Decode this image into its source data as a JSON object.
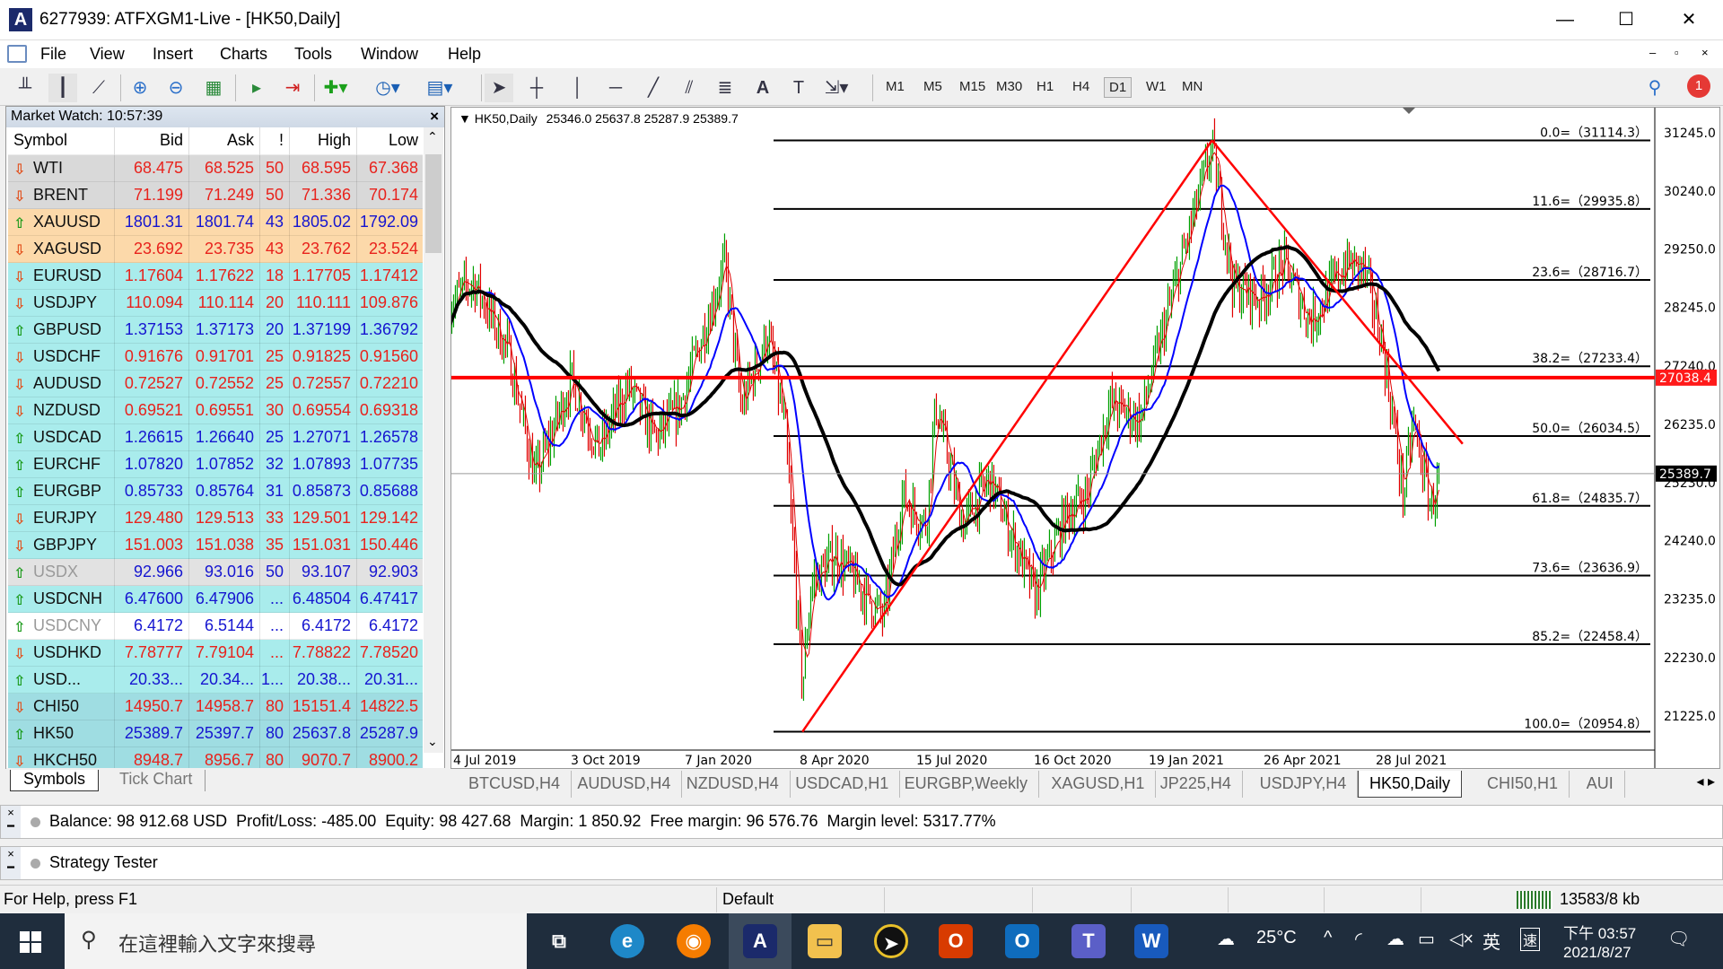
{
  "window": {
    "title": "6277939: ATFXGM1-Live - [HK50,Daily]",
    "minimize": "—",
    "maximize": "☐",
    "close": "✕"
  },
  "menu": [
    "File",
    "View",
    "Insert",
    "Charts",
    "Tools",
    "Window",
    "Help"
  ],
  "toolbar": {
    "timeframes": [
      "M1",
      "M5",
      "M15",
      "M30",
      "H1",
      "H4",
      "D1",
      "W1",
      "MN"
    ],
    "active_timeframe": "D1",
    "notification_count": "1"
  },
  "market_watch": {
    "title": "Market Watch: 10:57:39",
    "close": "×",
    "columns": [
      "Symbol",
      "Bid",
      "Ask",
      "!",
      "High",
      "Low"
    ],
    "rows": [
      {
        "symbol": "WTI",
        "bid": "68.475",
        "ask": "68.525",
        "spread": "50",
        "high": "68.595",
        "low": "67.368",
        "dir": "down",
        "bg": "#d9d9d9"
      },
      {
        "symbol": "BRENT",
        "bid": "71.199",
        "ask": "71.249",
        "spread": "50",
        "high": "71.336",
        "low": "70.174",
        "dir": "down",
        "bg": "#d9d9d9"
      },
      {
        "symbol": "XAUUSD",
        "bid": "1801.31",
        "ask": "1801.74",
        "spread": "43",
        "high": "1805.02",
        "low": "1792.09",
        "dir": "up",
        "bg": "#fcd9aa"
      },
      {
        "symbol": "XAGUSD",
        "bid": "23.692",
        "ask": "23.735",
        "spread": "43",
        "high": "23.762",
        "low": "23.524",
        "dir": "down",
        "bg": "#fcd9aa"
      },
      {
        "symbol": "EURUSD",
        "bid": "1.17604",
        "ask": "1.17622",
        "spread": "18",
        "high": "1.17705",
        "low": "1.17412",
        "dir": "down",
        "bg": "#a9ecec"
      },
      {
        "symbol": "USDJPY",
        "bid": "110.094",
        "ask": "110.114",
        "spread": "20",
        "high": "110.111",
        "low": "109.876",
        "dir": "down",
        "bg": "#a9ecec"
      },
      {
        "symbol": "GBPUSD",
        "bid": "1.37153",
        "ask": "1.37173",
        "spread": "20",
        "high": "1.37199",
        "low": "1.36792",
        "dir": "up",
        "bg": "#a9ecec"
      },
      {
        "symbol": "USDCHF",
        "bid": "0.91676",
        "ask": "0.91701",
        "spread": "25",
        "high": "0.91825",
        "low": "0.91560",
        "dir": "down",
        "bg": "#a9ecec"
      },
      {
        "symbol": "AUDUSD",
        "bid": "0.72527",
        "ask": "0.72552",
        "spread": "25",
        "high": "0.72557",
        "low": "0.72210",
        "dir": "down",
        "bg": "#a9ecec"
      },
      {
        "symbol": "NZDUSD",
        "bid": "0.69521",
        "ask": "0.69551",
        "spread": "30",
        "high": "0.69554",
        "low": "0.69318",
        "dir": "down",
        "bg": "#a9ecec"
      },
      {
        "symbol": "USDCAD",
        "bid": "1.26615",
        "ask": "1.26640",
        "spread": "25",
        "high": "1.27071",
        "low": "1.26578",
        "dir": "up",
        "bg": "#a9ecec"
      },
      {
        "symbol": "EURCHF",
        "bid": "1.07820",
        "ask": "1.07852",
        "spread": "32",
        "high": "1.07893",
        "low": "1.07735",
        "dir": "up",
        "bg": "#a9ecec"
      },
      {
        "symbol": "EURGBP",
        "bid": "0.85733",
        "ask": "0.85764",
        "spread": "31",
        "high": "0.85873",
        "low": "0.85688",
        "dir": "up",
        "bg": "#a9ecec"
      },
      {
        "symbol": "EURJPY",
        "bid": "129.480",
        "ask": "129.513",
        "spread": "33",
        "high": "129.501",
        "low": "129.142",
        "dir": "down",
        "bg": "#a9ecec"
      },
      {
        "symbol": "GBPJPY",
        "bid": "151.003",
        "ask": "151.038",
        "spread": "35",
        "high": "151.031",
        "low": "150.446",
        "dir": "down",
        "bg": "#a9ecec"
      },
      {
        "symbol": "USDX",
        "bid": "92.966",
        "ask": "93.016",
        "spread": "50",
        "high": "93.107",
        "low": "92.903",
        "dir": "up",
        "bg": "#e2e2e2",
        "muted": true
      },
      {
        "symbol": "USDCNH",
        "bid": "6.47600",
        "ask": "6.47906",
        "spread": "...",
        "high": "6.48504",
        "low": "6.47417",
        "dir": "up",
        "bg": "#a9ecec"
      },
      {
        "symbol": "USDCNY",
        "bid": "6.4172",
        "ask": "6.5144",
        "spread": "...",
        "high": "6.4172",
        "low": "6.4172",
        "dir": "up",
        "bg": "#ffffff",
        "muted": true
      },
      {
        "symbol": "USDHKD",
        "bid": "7.78777",
        "ask": "7.79104",
        "spread": "...",
        "high": "7.78822",
        "low": "7.78520",
        "dir": "down",
        "bg": "#a9ecec"
      },
      {
        "symbol": "USD...",
        "bid": "20.33...",
        "ask": "20.34...",
        "spread": "1...",
        "high": "20.38...",
        "low": "20.31...",
        "dir": "up",
        "bg": "#a9ecec"
      },
      {
        "symbol": "CHI50",
        "bid": "14950.7",
        "ask": "14958.7",
        "spread": "80",
        "high": "15151.4",
        "low": "14822.5",
        "dir": "down",
        "bg": "#9fdde2"
      },
      {
        "symbol": "HK50",
        "bid": "25389.7",
        "ask": "25397.7",
        "spread": "80",
        "high": "25637.8",
        "low": "25287.9",
        "dir": "up",
        "bg": "#9fdde2"
      },
      {
        "symbol": "HKCH50",
        "bid": "8948.7",
        "ask": "8956.7",
        "spread": "80",
        "high": "9070.7",
        "low": "8900.2",
        "dir": "down",
        "bg": "#9fdde2"
      }
    ],
    "tabs": [
      "Symbols",
      "Tick Chart"
    ],
    "active_tab": "Symbols"
  },
  "chart_tabs": [
    "BTCUSD,H4",
    "AUDUSD,H4",
    "NZDUSD,H4",
    "USDCAD,H1",
    "EURGBP,Weekly",
    "XAGUSD,H1",
    "JP225,H4",
    "USDJPY,H4",
    "HK50,Daily",
    "CHI50,H1",
    "AUI"
  ],
  "active_chart_tab": "HK50,Daily",
  "colors": {
    "up_bar": "#00a000",
    "down_bar": "#e00000",
    "sell_down": "#e8221c",
    "buy_up": "#1515d0",
    "fib": "#000000",
    "trendline": "#ff0000",
    "level_line": "#ff0000"
  },
  "chart_data": {
    "type": "bar",
    "header": "HK50,Daily",
    "ohlc": "25346.0 25637.8 25287.9 25389.7",
    "ylim": [
      20954.8,
      31245.0
    ],
    "y_ticks": [
      "31245.0",
      "30240.0",
      "29250.0",
      "28245.0",
      "27240.0",
      "26235.0",
      "25230.0",
      "24240.0",
      "23235.0",
      "22230.0",
      "21225.0"
    ],
    "x_ticks": [
      "4 Jul 2019",
      "3 Oct 2019",
      "7 Jan 2020",
      "8 Apr 2020",
      "15 Jul 2020",
      "16 Oct 2020",
      "19 Jan 2021",
      "26 Apr 2021",
      "28 Jul 2021"
    ],
    "fibonacci": [
      {
        "label": "0.0=（31114.3）",
        "price": 31114.3
      },
      {
        "label": "11.6=（29935.8）",
        "price": 29935.8
      },
      {
        "label": "23.6=（28716.7）",
        "price": 28716.7
      },
      {
        "label": "38.2=（27233.4）",
        "price": 27233.4
      },
      {
        "label": "50.0=（26034.5）",
        "price": 26034.5
      },
      {
        "label": "61.8=（24835.7）",
        "price": 24835.7
      },
      {
        "label": "73.6=（23636.9）",
        "price": 23636.9
      },
      {
        "label": "85.2=（22458.4）",
        "price": 22458.4
      },
      {
        "label": "100.0=（20954.8）",
        "price": 20954.8
      }
    ],
    "horizontal_line": {
      "price": 27038.4,
      "label": "27038.4"
    },
    "current_price": {
      "price": 25389.7,
      "label": "25389.7"
    },
    "trendlines": [
      {
        "from": [
          "2020-03-19",
          20954.8
        ],
        "to": [
          "2021-02-18",
          31114.3
        ]
      },
      {
        "from": [
          "2021-02-18",
          31114.3
        ],
        "to": [
          "2021-09-15",
          25900
        ]
      }
    ],
    "price_path": [
      [
        "2019-06-10",
        28300
      ],
      [
        "2019-06-28",
        28700
      ],
      [
        "2019-07-25",
        27500
      ],
      [
        "2019-08-15",
        25300
      ],
      [
        "2019-09-12",
        27000
      ],
      [
        "2019-10-03",
        25800
      ],
      [
        "2019-10-28",
        26900
      ],
      [
        "2019-11-20",
        26000
      ],
      [
        "2019-12-10",
        26500
      ],
      [
        "2020-01-17",
        29000
      ],
      [
        "2020-01-30",
        26500
      ],
      [
        "2020-02-20",
        27800
      ],
      [
        "2020-03-05",
        26200
      ],
      [
        "2020-03-19",
        21700
      ],
      [
        "2020-03-26",
        23500
      ],
      [
        "2020-04-15",
        24000
      ],
      [
        "2020-05-25",
        22900
      ],
      [
        "2020-06-10",
        25000
      ],
      [
        "2020-06-30",
        24500
      ],
      [
        "2020-07-08",
        26600
      ],
      [
        "2020-07-30",
        24500
      ],
      [
        "2020-08-20",
        25300
      ],
      [
        "2020-09-25",
        23300
      ],
      [
        "2020-10-20",
        24700
      ],
      [
        "2020-11-05",
        25000
      ],
      [
        "2020-11-25",
        26600
      ],
      [
        "2020-12-20",
        26300
      ],
      [
        "2021-01-10",
        28000
      ],
      [
        "2021-02-18",
        31000
      ],
      [
        "2021-03-08",
        28600
      ],
      [
        "2021-03-30",
        28400
      ],
      [
        "2021-04-20",
        29000
      ],
      [
        "2021-05-12",
        28000
      ],
      [
        "2021-06-10",
        29000
      ],
      [
        "2021-06-25",
        28900
      ],
      [
        "2021-07-10",
        27700
      ],
      [
        "2021-07-28",
        25000
      ],
      [
        "2021-08-05",
        26300
      ],
      [
        "2021-08-20",
        24800
      ],
      [
        "2021-08-27",
        25390
      ]
    ],
    "moving_averages": [
      {
        "color": "#e00000"
      },
      {
        "color": "#0000ff"
      },
      {
        "color": "#000000"
      }
    ]
  },
  "terminal": {
    "account": "Balance: 98 912.68 USD  Profit/Loss: -485.00  Equity: 98 427.68  Margin: 1 850.92  Free margin: 96 576.76  Margin level: 5317.77%"
  },
  "strategy_tester": {
    "label": "Strategy Tester"
  },
  "statusbar": {
    "help": "For Help, press F1",
    "profile": "Default",
    "traffic": "13583/8 kb"
  },
  "taskbar": {
    "search_placeholder": "在這裡輸入文字來搜尋",
    "weather": "25°C",
    "ime": "英",
    "time": "下午 03:57",
    "date": "2021/8/27"
  }
}
